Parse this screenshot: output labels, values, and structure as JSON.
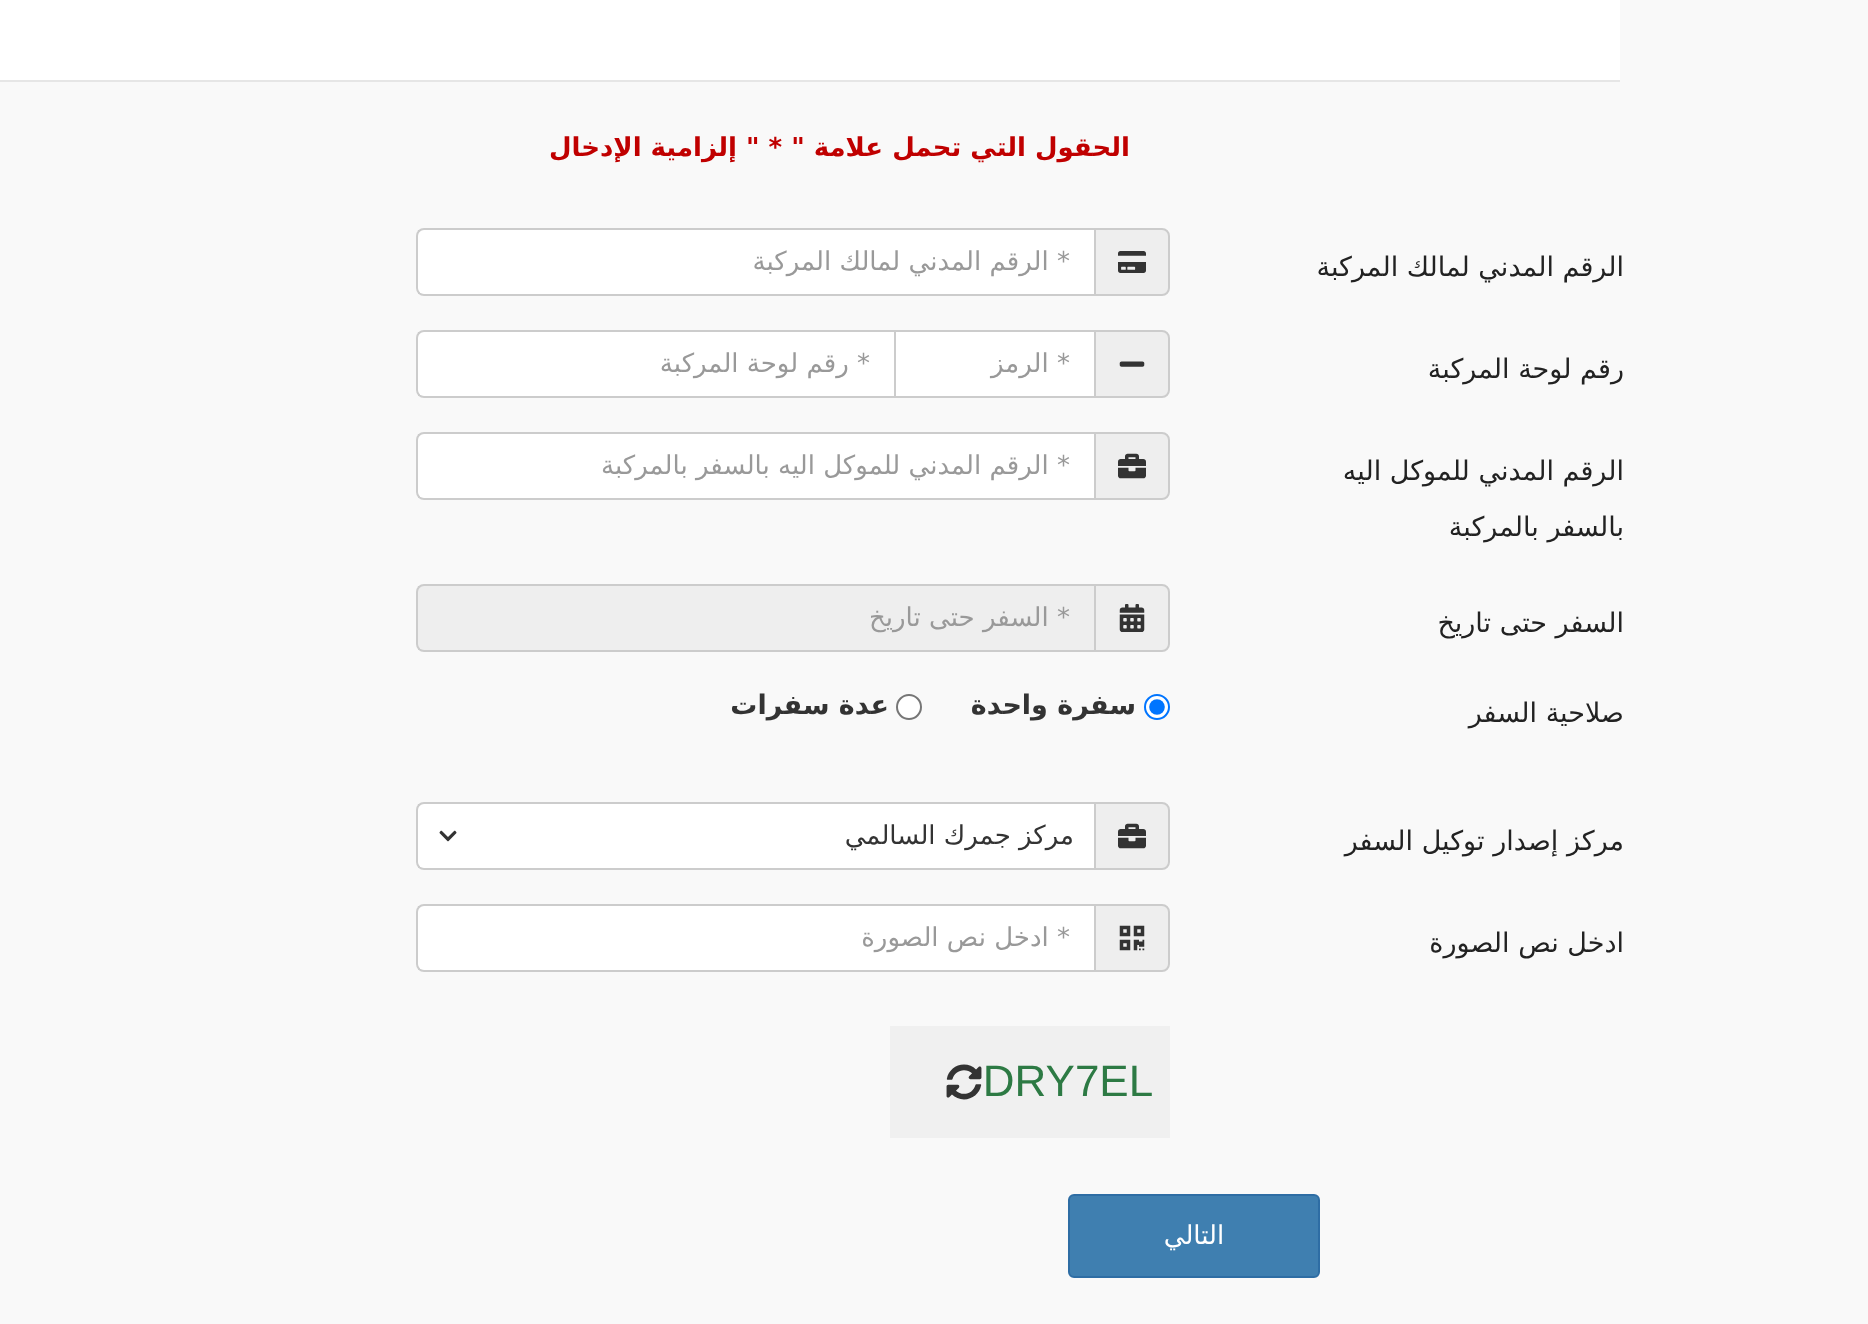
{
  "notice": "الحقول التي تحمل علامة \" * \" إلزامية الإدخال",
  "fields": [
    {
      "kind": "text",
      "label": "الرقم المدني لمالك المركبة",
      "placeholder": "* الرقم المدني لمالك المركبة",
      "disabled": false
    },
    {
      "kind": "plate",
      "label": "رقم لوحة المركبة",
      "placeholders": [
        "* الرمز",
        "* رقم لوحة المركبة"
      ]
    },
    {
      "kind": "text",
      "label": "الرقم المدني للموكل اليه بالسفر بالمركبة",
      "placeholder": "* الرقم المدني للموكل اليه بالسفر بالمركبة",
      "disabled": false
    },
    {
      "kind": "text",
      "label": "السفر حتى تاريخ",
      "placeholder": "* السفر حتى تاريخ",
      "disabled": true
    },
    {
      "kind": "radio",
      "label": "صلاحية السفر",
      "options": [
        {
          "label": "سفرة واحدة",
          "selected": true
        },
        {
          "label": "عدة سفرات",
          "selected": false
        }
      ]
    },
    {
      "kind": "select",
      "label": "مركز إصدار توكيل السفر",
      "value": "مركز جمرك السالمي"
    },
    {
      "kind": "text",
      "label": "ادخل نص الصورة",
      "placeholder": "* ادخل نص الصورة",
      "disabled": false
    }
  ],
  "captcha": {
    "text": "DRY7EL"
  },
  "next_button": "التالي"
}
